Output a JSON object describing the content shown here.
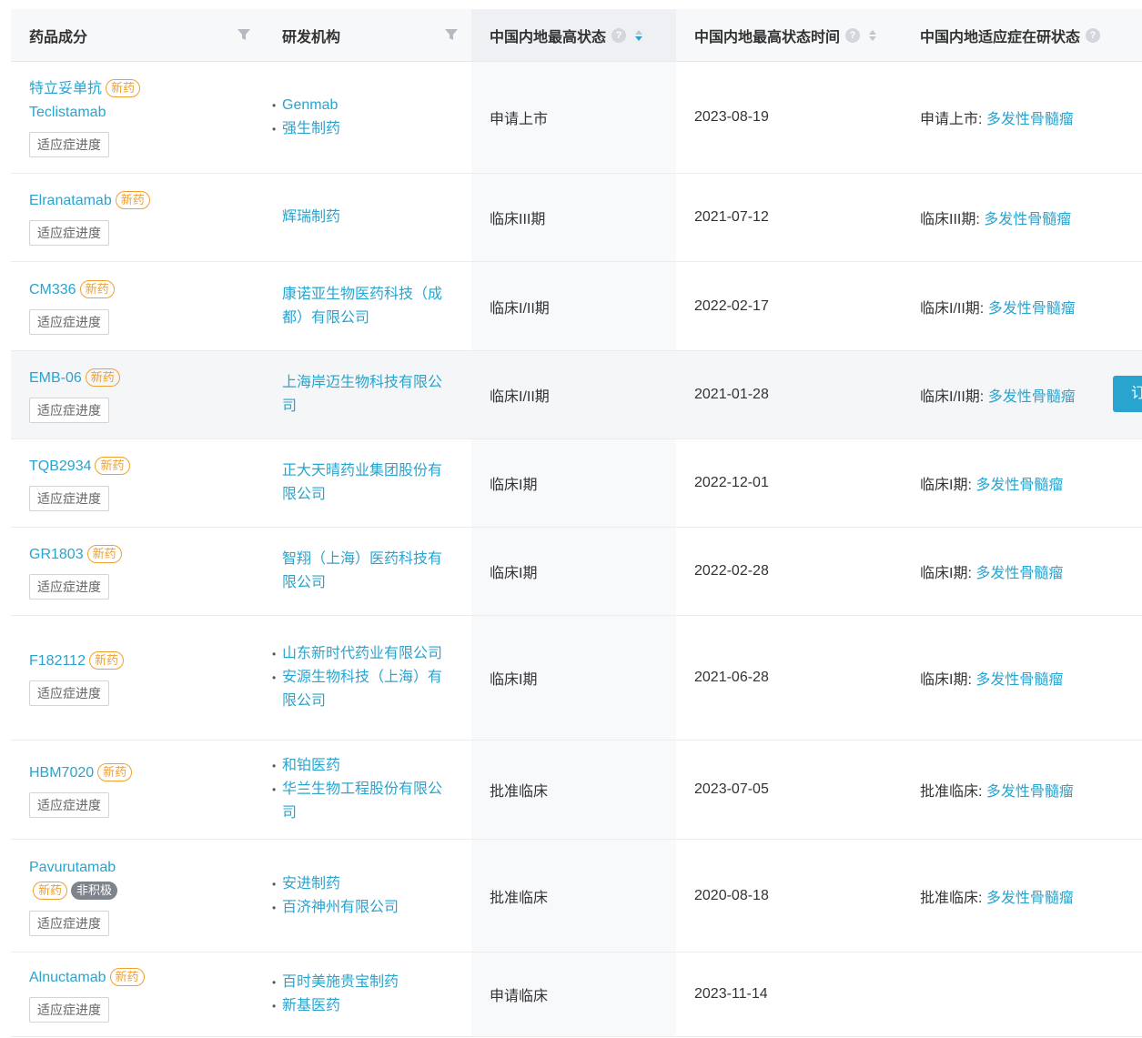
{
  "headers": {
    "drug": "药品成分",
    "org": "研发机构",
    "status": "中国内地最高状态",
    "status_time": "中国内地最高状态时间",
    "indication_status": "中国内地适应症在研状态"
  },
  "progress_label": "适应症进度",
  "rows": [
    {
      "name": "特立妥单抗",
      "name2": "Teclistamab",
      "badges": [
        "新药"
      ],
      "orgs": [
        "Genmab",
        "强生制药"
      ],
      "status": "申请上市",
      "date": "2023-08-19",
      "ind_prefix": "申请上市:",
      "ind_link": "多发性骨髓瘤"
    },
    {
      "name": "Elranatamab",
      "badges": [
        "新药"
      ],
      "orgs": [
        "辉瑞制药"
      ],
      "status": "临床III期",
      "date": "2021-07-12",
      "ind_prefix": "临床III期:",
      "ind_link": "多发性骨髓瘤"
    },
    {
      "name": "CM336",
      "badges": [
        "新药"
      ],
      "orgs": [
        "康诺亚生物医药科技（成都）有限公司"
      ],
      "status": "临床I/II期",
      "date": "2022-02-17",
      "ind_prefix": "临床I/II期:",
      "ind_link": "多发性骨髓瘤"
    },
    {
      "name": "EMB-06",
      "badges": [
        "新药"
      ],
      "orgs": [
        "上海岸迈生物科技有限公司"
      ],
      "status": "临床I/II期",
      "date": "2021-01-28",
      "ind_prefix": "临床I/II期:",
      "ind_link": "多发性骨髓瘤"
    },
    {
      "name": "TQB2934",
      "badges": [
        "新药"
      ],
      "orgs": [
        "正大天晴药业集团股份有限公司"
      ],
      "status": "临床I期",
      "date": "2022-12-01",
      "ind_prefix": "临床I期:",
      "ind_link": "多发性骨髓瘤"
    },
    {
      "name": "GR1803",
      "badges": [
        "新药"
      ],
      "orgs": [
        "智翔（上海）医药科技有限公司"
      ],
      "status": "临床I期",
      "date": "2022-02-28",
      "ind_prefix": "临床I期:",
      "ind_link": "多发性骨髓瘤"
    },
    {
      "name": "F182112",
      "badges": [
        "新药"
      ],
      "orgs": [
        "山东新时代药业有限公司",
        "安源生物科技（上海）有限公司"
      ],
      "status": "临床I期",
      "date": "2021-06-28",
      "ind_prefix": "临床I期:",
      "ind_link": "多发性骨髓瘤"
    },
    {
      "name": "HBM7020",
      "badges": [
        "新药"
      ],
      "orgs": [
        "和铂医药",
        "华兰生物工程股份有限公司"
      ],
      "status": "批准临床",
      "date": "2023-07-05",
      "ind_prefix": "批准临床:",
      "ind_link": "多发性骨髓瘤"
    },
    {
      "name": "Pavurutamab",
      "badges": [
        "新药",
        "非积极"
      ],
      "orgs": [
        "安进制药",
        "百济神州有限公司"
      ],
      "status": "批准临床",
      "date": "2020-08-18",
      "ind_prefix": "批准临床:",
      "ind_link": "多发性骨髓瘤"
    },
    {
      "name": "Alnuctamab",
      "badges": [
        "新药"
      ],
      "orgs": [
        "百时美施贵宝制药",
        "新基医药"
      ],
      "status": "申请临床",
      "date": "2023-11-14",
      "ind_prefix": "",
      "ind_link": ""
    }
  ],
  "side_button": "订",
  "colors": {
    "link": "#29a4cf",
    "badge": "#f0a030",
    "header_bg": "#f7f8fa"
  },
  "icons": {
    "filter": "filter-icon",
    "help": "help-icon",
    "sort": "sort-icon"
  }
}
